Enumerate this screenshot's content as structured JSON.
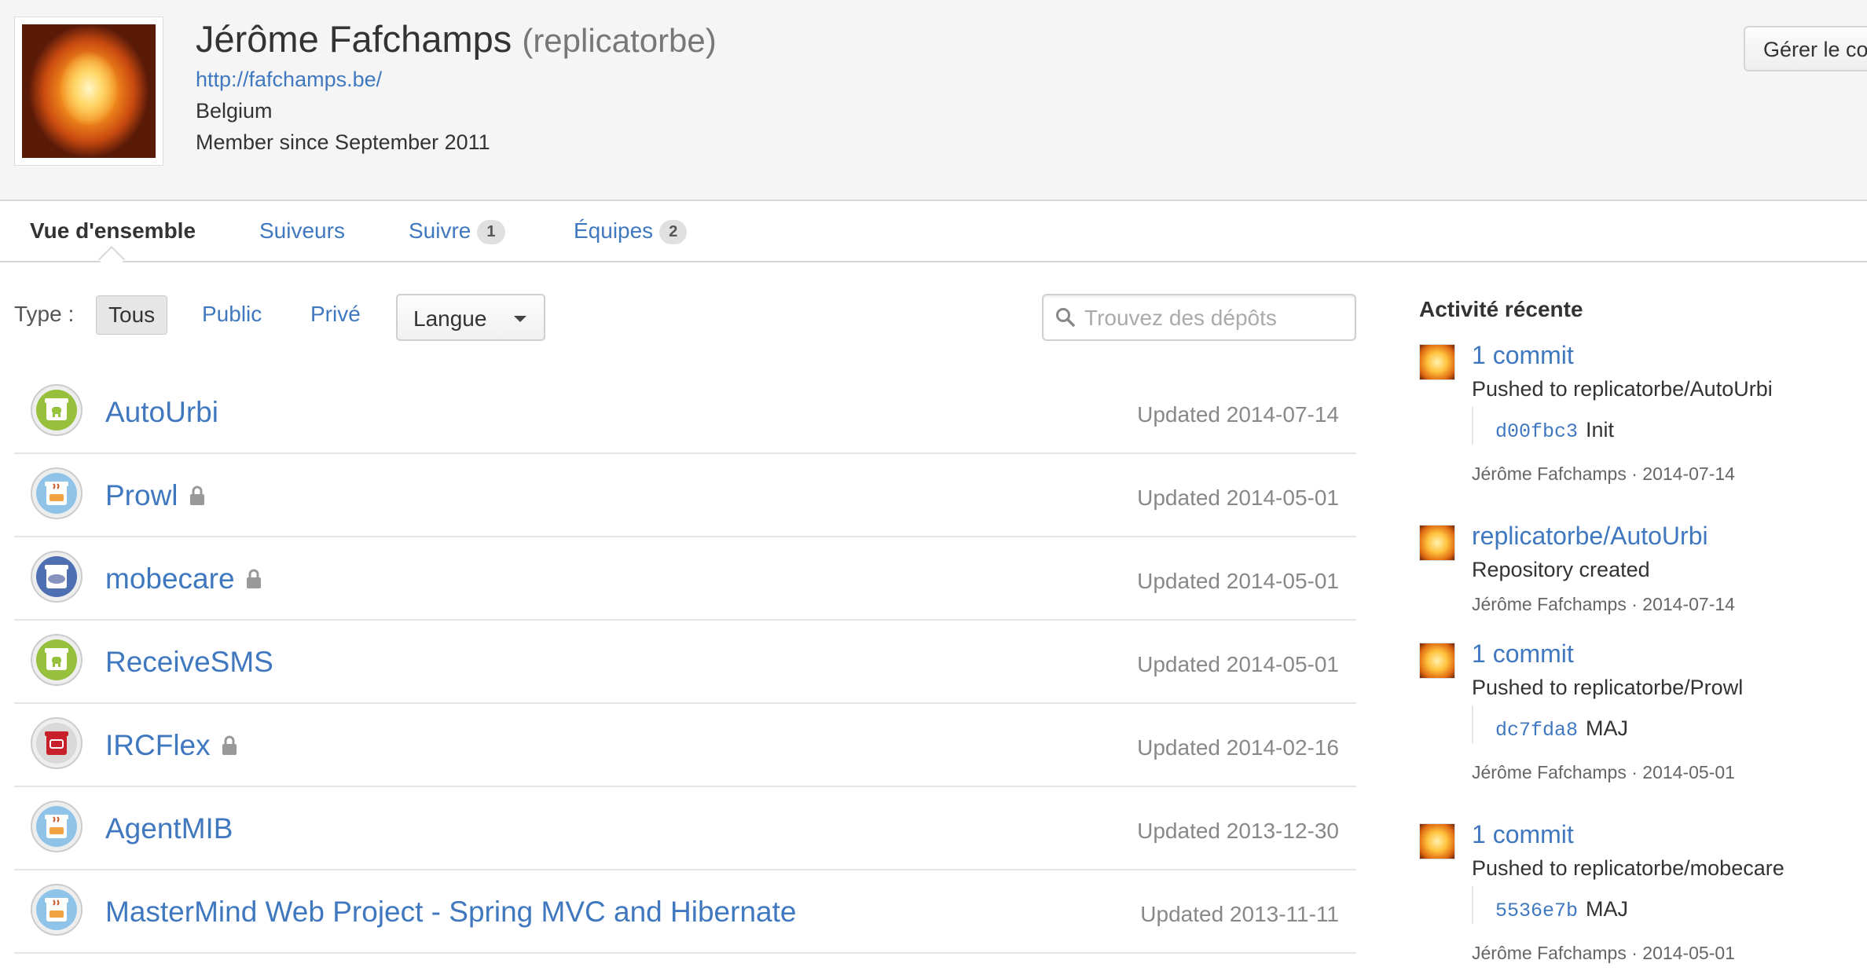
{
  "profile": {
    "name": "Jérôme Fafchamps",
    "login": "(replicatorbe)",
    "url": "http://fafchamps.be/",
    "location": "Belgium",
    "member_since": "Member since September 2011",
    "manage_button": "Gérer le compte"
  },
  "tabs": [
    {
      "label": "Vue d'ensemble",
      "count": null,
      "selected": true
    },
    {
      "label": "Suiveurs",
      "count": null,
      "selected": false
    },
    {
      "label": "Suivre",
      "count": "1",
      "selected": false
    },
    {
      "label": "Équipes",
      "count": "2",
      "selected": false
    }
  ],
  "filters": {
    "type_label": "Type :",
    "all": "Tous",
    "public": "Public",
    "private": "Privé",
    "language": "Langue",
    "search_placeholder": "Trouvez des dépôts"
  },
  "repos": [
    {
      "name": "AutoUrbi",
      "private": false,
      "updated": "Updated 2014-07-14",
      "lang_icon": "android-icon"
    },
    {
      "name": "Prowl",
      "private": true,
      "updated": "Updated 2014-05-01",
      "lang_icon": "java-icon"
    },
    {
      "name": "mobecare",
      "private": true,
      "updated": "Updated 2014-05-01",
      "lang_icon": "php-icon"
    },
    {
      "name": "ReceiveSMS",
      "private": false,
      "updated": "Updated 2014-05-01",
      "lang_icon": "android-icon"
    },
    {
      "name": "IRCFlex",
      "private": true,
      "updated": "Updated 2014-02-16",
      "lang_icon": "actionscript-icon"
    },
    {
      "name": "AgentMIB",
      "private": false,
      "updated": "Updated 2013-12-30",
      "lang_icon": "java-icon"
    },
    {
      "name": "MasterMind Web Project - Spring MVC and Hibernate",
      "private": false,
      "updated": "Updated 2013-11-11",
      "lang_icon": "java-icon"
    }
  ],
  "activity": {
    "title": "Activité récente",
    "items": [
      {
        "title": "1 commit",
        "sub": "Pushed to replicatorbe/AutoUrbi",
        "sha": "d00fbc3",
        "msg": "Init",
        "meta": "Jérôme Fafchamps · 2014-07-14"
      },
      {
        "title": "replicatorbe/AutoUrbi",
        "sub": "Repository created",
        "sha": null,
        "msg": null,
        "meta": "Jérôme Fafchamps · 2014-07-14"
      },
      {
        "title": "1 commit",
        "sub": "Pushed to replicatorbe/Prowl",
        "sha": "dc7fda8",
        "msg": "MAJ",
        "meta": "Jérôme Fafchamps · 2014-05-01"
      },
      {
        "title": "1 commit",
        "sub": "Pushed to replicatorbe/mobecare",
        "sha": "5536e7b",
        "msg": "MAJ",
        "meta": "Jérôme Fafchamps · 2014-05-01"
      }
    ]
  },
  "colors": {
    "link": "#4078c0",
    "android": "#97c03d",
    "java": "#8fc4e8",
    "php": "#4f6fb3",
    "actionscript": "#c8202b"
  }
}
